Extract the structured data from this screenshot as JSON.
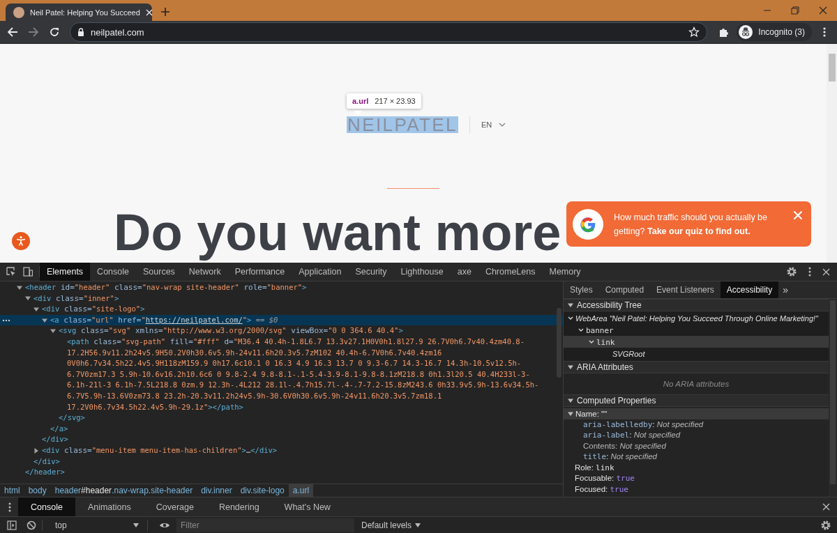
{
  "browser": {
    "tabs": [
      {
        "title": "Neil Patel: Helping You Succeed",
        "selected": true
      }
    ],
    "address": "neilpatel.com",
    "forward_enabled": false,
    "profile": "Incognito (3)"
  },
  "page": {
    "tooltip": {
      "selector": "a.url",
      "size": "217 × 23.93"
    },
    "logo": "NEILPATEL",
    "language": "EN",
    "headline": "Do you want more",
    "popup": {
      "text": "How much traffic should you actually be getting? **Take our quiz to find out.**"
    }
  },
  "devtools": {
    "tabs": [
      {
        "label": "Elements",
        "selected": true
      },
      {
        "label": "Console",
        "selected": false
      },
      {
        "label": "Sources",
        "selected": false
      },
      {
        "label": "Network",
        "selected": false
      },
      {
        "label": "Performance",
        "selected": false
      },
      {
        "label": "Application",
        "selected": false
      },
      {
        "label": "Security",
        "selected": false
      },
      {
        "label": "Lighthouse",
        "selected": false
      },
      {
        "label": "axe",
        "selected": false
      },
      {
        "label": "ChromeLens",
        "selected": false
      },
      {
        "label": "Memory",
        "selected": false
      }
    ],
    "dom": [
      {
        "expanded": true,
        "selected": false,
        "lines": [
          [
            {
              "kind": "tag",
              "text": "<header"
            },
            {
              "kind": "attr",
              "text": " id="
            },
            {
              "kind": "value",
              "text": "\"header\""
            },
            {
              "kind": "attr",
              "text": " class="
            },
            {
              "kind": "value",
              "text": "\"nav-wrap site-header\""
            },
            {
              "kind": "attr",
              "text": " role="
            },
            {
              "kind": "value",
              "text": "\"banner\""
            },
            {
              "kind": "tag",
              "text": ">"
            }
          ]
        ],
        "close": [
          {
            "kind": "tag",
            "text": "</header>"
          }
        ],
        "children": [
          {
            "expanded": true,
            "selected": false,
            "lines": [
              [
                {
                  "kind": "tag",
                  "text": "<div"
                },
                {
                  "kind": "attr",
                  "text": " class="
                },
                {
                  "kind": "value",
                  "text": "\"inner\""
                },
                {
                  "kind": "tag",
                  "text": ">"
                }
              ]
            ],
            "close": [
              {
                "kind": "tag",
                "text": "</div>"
              }
            ],
            "children": [
              {
                "expanded": true,
                "selected": false,
                "lines": [
                  [
                    {
                      "kind": "tag",
                      "text": "<div"
                    },
                    {
                      "kind": "attr",
                      "text": " class="
                    },
                    {
                      "kind": "value",
                      "text": "\"site-logo\""
                    },
                    {
                      "kind": "tag",
                      "text": ">"
                    }
                  ]
                ],
                "close": [
                  {
                    "kind": "tag",
                    "text": "</div>"
                  }
                ],
                "children": [
                  {
                    "expanded": true,
                    "selected": true,
                    "lines": [
                      [
                        {
                          "kind": "tag",
                          "text": "<a"
                        },
                        {
                          "kind": "attr",
                          "text": " class="
                        },
                        {
                          "kind": "value",
                          "text": "\"url\""
                        },
                        {
                          "kind": "attr",
                          "text": " href="
                        },
                        {
                          "kind": "value",
                          "text": "\""
                        },
                        {
                          "kind": "link",
                          "text": "https://neilpatel.com/"
                        },
                        {
                          "kind": "value",
                          "text": "\""
                        },
                        {
                          "kind": "tag",
                          "text": ">"
                        },
                        {
                          "kind": "hint",
                          "text": " == $0"
                        }
                      ]
                    ],
                    "close": [
                      {
                        "kind": "tag",
                        "text": "</a>"
                      }
                    ],
                    "children": [
                      {
                        "expanded": true,
                        "selected": false,
                        "lines": [
                          [
                            {
                              "kind": "tag",
                              "text": "<svg"
                            },
                            {
                              "kind": "attr",
                              "text": " class="
                            },
                            {
                              "kind": "value",
                              "text": "\"svg\""
                            },
                            {
                              "kind": "attr",
                              "text": " xmlns="
                            },
                            {
                              "kind": "value",
                              "text": "\"http://www.w3.org/2000/svg\""
                            },
                            {
                              "kind": "attr",
                              "text": " viewBox="
                            },
                            {
                              "kind": "value",
                              "text": "\"0 0 364.6 40.4\""
                            },
                            {
                              "kind": "tag",
                              "text": ">"
                            }
                          ]
                        ],
                        "close": [
                          {
                            "kind": "tag",
                            "text": "</svg>"
                          }
                        ],
                        "children": [
                          {
                            "selected": false,
                            "lines": [
                              [
                                {
                                  "kind": "tag",
                                  "text": "<path"
                                },
                                {
                                  "kind": "attr",
                                  "text": " class="
                                },
                                {
                                  "kind": "value",
                                  "text": "\"svg-path\""
                                },
                                {
                                  "kind": "attr",
                                  "text": " fill="
                                },
                                {
                                  "kind": "value",
                                  "text": "\"#fff\""
                                },
                                {
                                  "kind": "attr",
                                  "text": " d="
                                },
                                {
                                  "kind": "value",
                                  "text": "\"M36.4 40.4h-1.8L6.7 13.3v27.1H0V0h1.8l27.9 26.7V0h6.7v40.4zm40.8-"
                                }
                              ],
                              [
                                {
                                  "kind": "value",
                                  "text": "17.2H56.9v11.2h24v5.9H50.2V0h30.6v5.9h-24v11.6h20.3v5.7zM102 40.4h-6.7V0h6.7v40.4zm16"
                                }
                              ],
                              [
                                {
                                  "kind": "value",
                                  "text": "0V0h6.7v34.5h22.4v5.9H118zM159.9 0h17.6c10.1 0 16.3 4.9 16.3 13.7 0 9.3-6.7 14.3-16.7 14.3h-10.5v12.5h-"
                                }
                              ],
                              [
                                {
                                  "kind": "value",
                                  "text": "6.7V0zm17.3 5.9h-10.6v16.2h10.6c6 0 9.8-2.4 9.8-8.1-.1-5.4-3.9-8.1-9.8-8.1zM218.8 0h1.3l20.5 40.4H233l-3-"
                                }
                              ],
                              [
                                {
                                  "kind": "value",
                                  "text": "6.1h-21l-3 6.1h-7.5L218.8 0zm.9 12.3h-.4L212 28.1l-.4.7h15.7l-.4-.7-7.2-15.8zM243.6 0h33.9v5.9h-13.6v34.5h-"
                                }
                              ],
                              [
                                {
                                  "kind": "value",
                                  "text": "6.7V5.9h-13.6V0zm73.8 23.2h-20.3v11.2h24v5.9h-30.6V0h30.6v5.9h-24v11.6h20.3v5.7zm18.1"
                                }
                              ],
                              [
                                {
                                  "kind": "value",
                                  "text": "17.2V0h6.7v34.5h22.4v5.9h-29.1z\""
                                },
                                {
                                  "kind": "tag",
                                  "text": "></path>"
                                }
                              ]
                            ]
                          }
                        ]
                      }
                    ]
                  }
                ]
              },
              {
                "expanded": false,
                "selected": false,
                "lines": [
                  [
                    {
                      "kind": "tag",
                      "text": "<div"
                    },
                    {
                      "kind": "attr",
                      "text": " class="
                    },
                    {
                      "kind": "value",
                      "text": "\"menu-item menu-item-has-children\""
                    },
                    {
                      "kind": "tag",
                      "text": ">"
                    },
                    {
                      "kind": "plain",
                      "text": "…"
                    },
                    {
                      "kind": "tag",
                      "text": "</div>"
                    }
                  ]
                ]
              }
            ]
          }
        ]
      }
    ],
    "sidebar": {
      "tabs": [
        {
          "label": "Styles",
          "selected": false
        },
        {
          "label": "Computed",
          "selected": false
        },
        {
          "label": "Event Listeners",
          "selected": false
        },
        {
          "label": "Accessibility",
          "selected": true
        }
      ],
      "overflow": "»",
      "sections": [
        {
          "kind": "tree",
          "title": "Accessibility Tree",
          "expanded": true,
          "tree": [
            {
              "kind": "generic",
              "role": "WebArea",
              "label": " \"Neil Patel: Helping You Succeed Through Online Marketing!\"",
              "expanded": true,
              "selected": false,
              "children": [
                {
                  "kind": "role",
                  "role": "banner",
                  "expanded": true,
                  "selected": false,
                  "children": [
                    {
                      "kind": "role",
                      "role": "link",
                      "expanded": true,
                      "selected": true,
                      "children": [
                        {
                          "kind": "generic",
                          "role": "SVGRoot",
                          "selected": false
                        }
                      ]
                    }
                  ]
                }
              ]
            }
          ]
        },
        {
          "kind": "empty",
          "title": "ARIA Attributes",
          "expanded": true,
          "message": "No ARIA attributes"
        },
        {
          "kind": "props",
          "title": "Computed Properties",
          "expanded": true,
          "props": [
            {
              "selected": true,
              "expanded": true,
              "tokens": [
                {
                  "kind": "plain",
                  "text": "Name: \"\""
                }
              ],
              "children": [
                {
                  "selected": false,
                  "tokens": [
                    {
                      "kind": "attr",
                      "text": "aria-labelledby"
                    },
                    {
                      "kind": "plain",
                      "text": ": "
                    },
                    {
                      "kind": "italic",
                      "text": "Not specified"
                    }
                  ]
                },
                {
                  "selected": false,
                  "tokens": [
                    {
                      "kind": "attr",
                      "text": "aria-label"
                    },
                    {
                      "kind": "plain",
                      "text": ": "
                    },
                    {
                      "kind": "italic",
                      "text": "Not specified"
                    }
                  ]
                },
                {
                  "selected": false,
                  "tokens": [
                    {
                      "kind": "dim",
                      "text": "Contents: "
                    },
                    {
                      "kind": "italic",
                      "text": "Not specified"
                    }
                  ]
                },
                {
                  "selected": false,
                  "tokens": [
                    {
                      "kind": "attr",
                      "text": "title"
                    },
                    {
                      "kind": "plain",
                      "text": ": "
                    },
                    {
                      "kind": "italic",
                      "text": "Not specified"
                    }
                  ]
                }
              ]
            },
            {
              "selected": false,
              "tokens": [
                {
                  "kind": "plain",
                  "text": "Role: "
                },
                {
                  "kind": "mono",
                  "text": "link"
                }
              ]
            },
            {
              "selected": false,
              "tokens": [
                {
                  "kind": "plain",
                  "text": "Focusable: "
                },
                {
                  "kind": "keyword",
                  "text": "true"
                }
              ]
            },
            {
              "selected": false,
              "tokens": [
                {
                  "kind": "plain",
                  "text": "Focused: "
                },
                {
                  "kind": "keyword",
                  "text": "true"
                }
              ]
            }
          ]
        }
      ]
    },
    "breadcrumbs": [
      {
        "selected": false,
        "parts": [
          {
            "kind": "tag",
            "text": "html"
          }
        ]
      },
      {
        "selected": false,
        "parts": [
          {
            "kind": "tag",
            "text": "body"
          }
        ]
      },
      {
        "selected": false,
        "parts": [
          {
            "kind": "tag",
            "text": "header"
          },
          {
            "kind": "plain",
            "text": "#header"
          },
          {
            "kind": "tag",
            "text": ".nav-wrap.site-header"
          }
        ]
      },
      {
        "selected": false,
        "parts": [
          {
            "kind": "tag",
            "text": "div.inner"
          }
        ]
      },
      {
        "selected": false,
        "parts": [
          {
            "kind": "tag",
            "text": "div.site-logo"
          }
        ]
      },
      {
        "selected": true,
        "parts": [
          {
            "kind": "tag",
            "text": "a.url"
          }
        ]
      }
    ]
  },
  "drawer": {
    "tabs": [
      {
        "label": "Console",
        "selected": true
      },
      {
        "label": "Animations",
        "selected": false
      },
      {
        "label": "Coverage",
        "selected": false
      },
      {
        "label": "Rendering",
        "selected": false
      },
      {
        "label": "What's New",
        "selected": false
      }
    ],
    "context": "top",
    "filter_placeholder": "Filter",
    "levels": "Default levels"
  }
}
